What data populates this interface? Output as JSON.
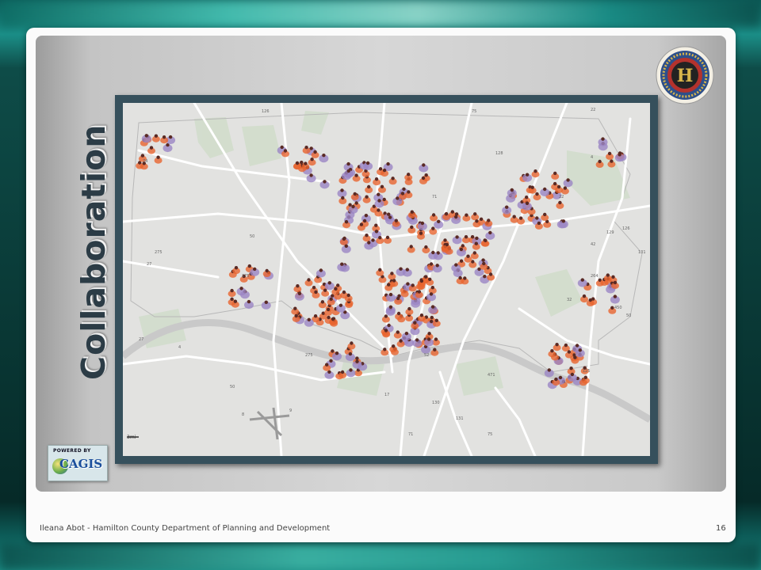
{
  "slide": {
    "title": "Collaboration",
    "footer_text": "Ileana Abot - Hamilton County Department of Planning and Development",
    "page_number": "16"
  },
  "logo": {
    "seal_letter": "H",
    "powered_by": "POWERED BY",
    "cagis": "CAGIS"
  },
  "map": {
    "scale_label": "3mi",
    "route_labels": [
      "126",
      "75",
      "71",
      "74",
      "275",
      "27",
      "128",
      "50",
      "42",
      "264",
      "22",
      "129",
      "32",
      "125",
      "471",
      "52",
      "275",
      "27",
      "4",
      "50",
      "8",
      "9",
      "17",
      "130",
      "131",
      "450",
      "50",
      "131",
      "126",
      "4",
      "22",
      "275",
      "71",
      "75"
    ],
    "marker_colors": {
      "orange": "#e9652f",
      "purple": "#9b86c4",
      "pin": "#5a2a24"
    }
  },
  "colors": {
    "frame": "#36505c",
    "title": "#2c3c46"
  }
}
